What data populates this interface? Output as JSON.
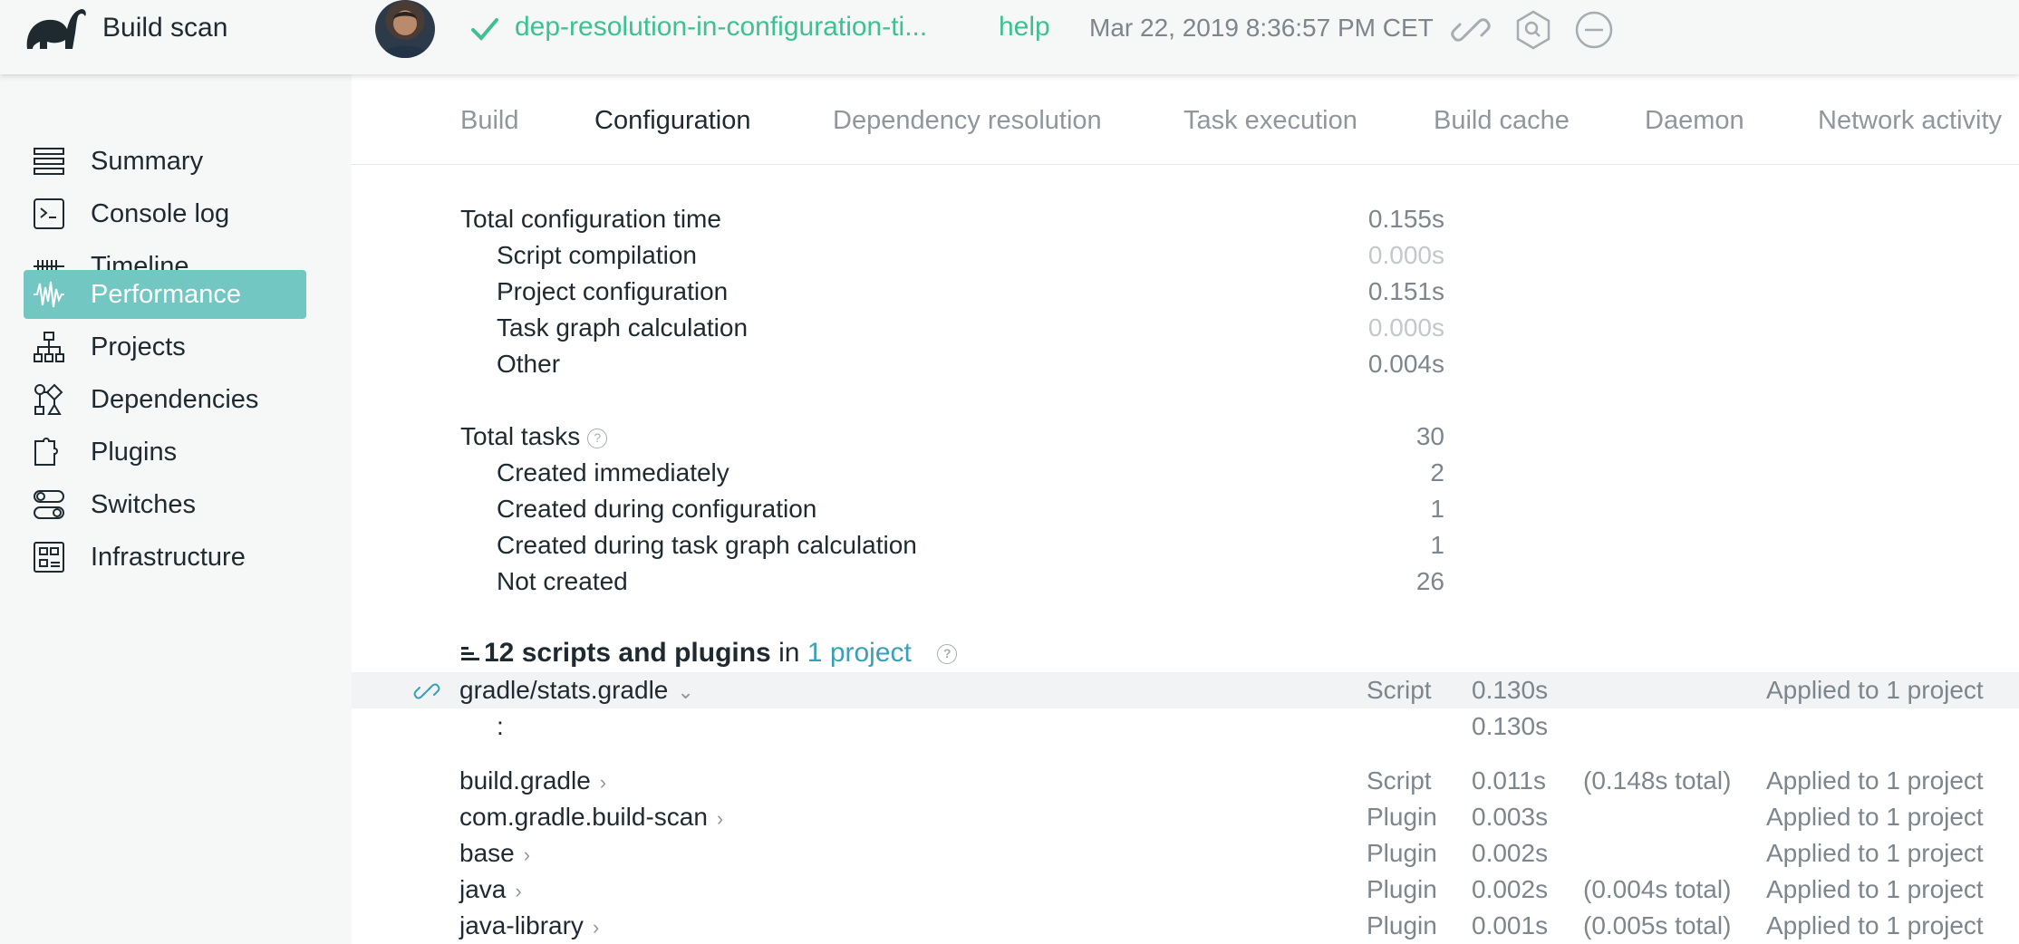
{
  "app": {
    "title": "Build scan",
    "accent_color": "#3fbf94",
    "active_nav_color": "#72c7c3"
  },
  "header": {
    "build_name": "dep-resolution-in-configuration-ti...",
    "help_label": "help",
    "timestamp": "Mar 22, 2019 8:36:57 PM CET",
    "icons": [
      "check-icon",
      "link-icon",
      "search-icon",
      "minus-circle-icon"
    ]
  },
  "sidebar": {
    "items": [
      {
        "label": "Summary",
        "icon": "list-icon"
      },
      {
        "label": "Console log",
        "icon": "terminal-icon"
      },
      {
        "label": "Timeline",
        "icon": "timeline-icon"
      },
      {
        "label": "Performance",
        "icon": "waveform-icon",
        "active": true
      },
      {
        "label": "Projects",
        "icon": "hierarchy-icon"
      },
      {
        "label": "Dependencies",
        "icon": "dependencies-icon"
      },
      {
        "label": "Plugins",
        "icon": "puzzle-icon"
      },
      {
        "label": "Switches",
        "icon": "toggle-icon"
      },
      {
        "label": "Infrastructure",
        "icon": "chip-icon"
      }
    ]
  },
  "tabs": [
    {
      "label": "Build"
    },
    {
      "label": "Configuration",
      "active": true
    },
    {
      "label": "Dependency resolution"
    },
    {
      "label": "Task execution"
    },
    {
      "label": "Build cache"
    },
    {
      "label": "Daemon"
    },
    {
      "label": "Network activity"
    }
  ],
  "configuration": {
    "total_label": "Total configuration time",
    "total_value": "0.155s",
    "breakdown": [
      {
        "label": "Script compilation",
        "value": "0.000s",
        "dim": true
      },
      {
        "label": "Project configuration",
        "value": "0.151s",
        "dim": false
      },
      {
        "label": "Task graph calculation",
        "value": "0.000s",
        "dim": true
      },
      {
        "label": "Other",
        "value": "0.004s",
        "dim": false
      }
    ]
  },
  "tasks": {
    "total_label": "Total tasks",
    "total_value": "30",
    "breakdown": [
      {
        "label": "Created immediately",
        "value": "2"
      },
      {
        "label": "Created during configuration",
        "value": "1"
      },
      {
        "label": "Created during task graph calculation",
        "value": "1"
      },
      {
        "label": "Not created",
        "value": "26"
      }
    ]
  },
  "scripts": {
    "count_label": "12 scripts and plugins",
    "in_label": "in",
    "project_link": "1 project",
    "rows": [
      {
        "name": "gradle/stats.gradle",
        "type": "Script",
        "time": "0.130s",
        "total": "",
        "applied": "Applied to 1 project",
        "expanded": true
      },
      {
        "name": ":",
        "type": "",
        "time": "0.130s",
        "total": "",
        "applied": "",
        "child": true
      },
      {
        "name": "build.gradle",
        "type": "Script",
        "time": "0.011s",
        "total": "(0.148s total)",
        "applied": "Applied to 1 project"
      },
      {
        "name": "com.gradle.build-scan",
        "type": "Plugin",
        "time": "0.003s",
        "total": "",
        "applied": "Applied to 1 project"
      },
      {
        "name": "base",
        "type": "Plugin",
        "time": "0.002s",
        "total": "",
        "applied": "Applied to 1 project"
      },
      {
        "name": "java",
        "type": "Plugin",
        "time": "0.002s",
        "total": "(0.004s total)",
        "applied": "Applied to 1 project"
      },
      {
        "name": "java-library",
        "type": "Plugin",
        "time": "0.001s",
        "total": "(0.005s total)",
        "applied": "Applied to 1 project"
      }
    ]
  }
}
